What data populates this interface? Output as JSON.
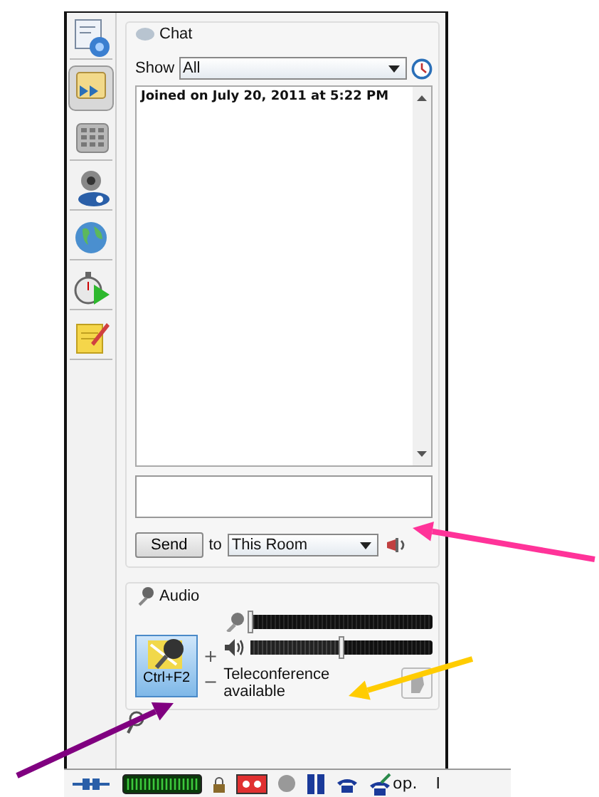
{
  "sidebar": {
    "items": [
      {
        "selected": false
      },
      {
        "selected": true
      },
      {
        "selected": false
      },
      {
        "selected": false
      },
      {
        "selected": false
      },
      {
        "selected": false
      },
      {
        "selected": false
      }
    ]
  },
  "chat": {
    "title": "Chat",
    "show_label": "Show",
    "show_value": "All",
    "log": [
      "Joined on July 20, 2011 at 5:22 PM"
    ],
    "send_button": "Send",
    "to_label": "to",
    "recipient": "This Room"
  },
  "audio": {
    "title": "Audio",
    "talk_button": "Ctrl+F2",
    "plus": "+",
    "minus": "−",
    "mic": {
      "level": 0.0
    },
    "speaker": {
      "level": 0.5
    },
    "status": "Teleconference available"
  },
  "status_bar": {
    "texts": [
      "op.",
      "I"
    ]
  },
  "annotations": [
    {
      "color": "#ff3399"
    },
    {
      "color": "#ffcc00"
    },
    {
      "color": "#800080"
    }
  ]
}
